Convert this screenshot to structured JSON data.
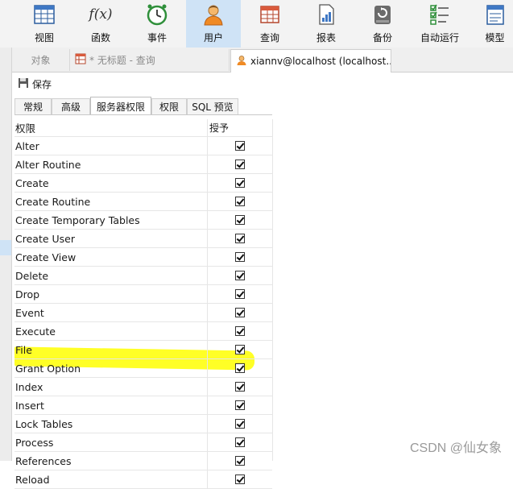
{
  "toolbar": {
    "items": [
      {
        "label": "视图",
        "icon": "table-view-icon"
      },
      {
        "label": "函数",
        "icon": "function-icon"
      },
      {
        "label": "事件",
        "icon": "clock-icon"
      },
      {
        "label": "用户",
        "icon": "user-icon",
        "active": true
      },
      {
        "label": "查询",
        "icon": "query-grid-icon"
      },
      {
        "label": "报表",
        "icon": "report-icon"
      },
      {
        "label": "备份",
        "icon": "backup-icon"
      },
      {
        "label": "自动运行",
        "icon": "checklist-icon"
      },
      {
        "label": "模型",
        "icon": "model-icon"
      }
    ],
    "function_glyph": "f(x)"
  },
  "doc_tabs": [
    {
      "label": "对象"
    },
    {
      "label": "* 无标题 - 查询"
    },
    {
      "label": "xiannv@localhost (localhost..."
    }
  ],
  "save_label": "保存",
  "sub_tabs": [
    "常规",
    "高级",
    "服务器权限",
    "权限",
    "SQL 预览"
  ],
  "active_sub_tab": "服务器权限",
  "grid": {
    "col_privilege": "权限",
    "col_grant": "授予",
    "rows": [
      {
        "name": "Alter",
        "checked": true
      },
      {
        "name": "Alter Routine",
        "checked": true
      },
      {
        "name": "Create",
        "checked": true
      },
      {
        "name": "Create Routine",
        "checked": true
      },
      {
        "name": "Create Temporary Tables",
        "checked": true
      },
      {
        "name": "Create User",
        "checked": true
      },
      {
        "name": "Create View",
        "checked": true
      },
      {
        "name": "Delete",
        "checked": true
      },
      {
        "name": "Drop",
        "checked": true
      },
      {
        "name": "Event",
        "checked": true
      },
      {
        "name": "Execute",
        "checked": true
      },
      {
        "name": "File",
        "checked": true
      },
      {
        "name": "Grant Option",
        "checked": true,
        "highlighted": true
      },
      {
        "name": "Index",
        "checked": true
      },
      {
        "name": "Insert",
        "checked": true
      },
      {
        "name": "Lock Tables",
        "checked": true
      },
      {
        "name": "Process",
        "checked": true
      },
      {
        "name": "References",
        "checked": true
      },
      {
        "name": "Reload",
        "checked": true
      }
    ]
  },
  "colors": {
    "accent": "#cfe3f6",
    "highlight": "#ffff00"
  },
  "watermark": "CSDN @仙女象"
}
